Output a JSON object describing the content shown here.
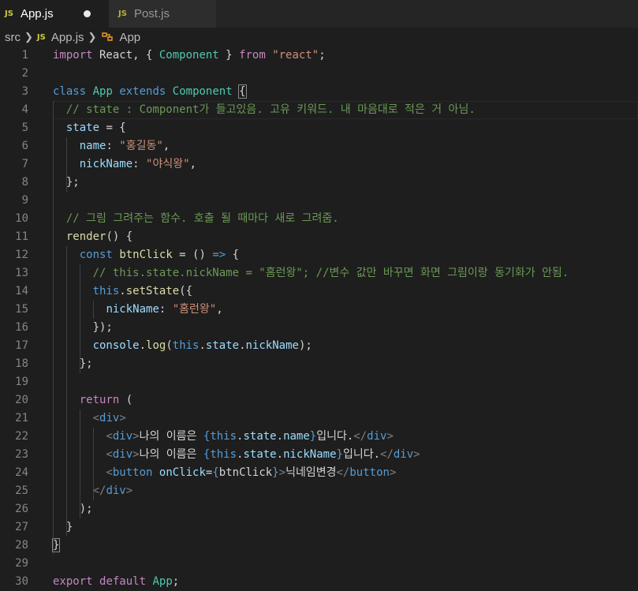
{
  "tabs": [
    {
      "label": "App.js",
      "badge": "JS",
      "active": true,
      "unsaved": true
    },
    {
      "label": "Post.js",
      "badge": "JS",
      "active": false
    }
  ],
  "breadcrumb": {
    "folder": "src",
    "file": "App.js",
    "file_badge": "JS",
    "symbol": "App"
  },
  "editor": {
    "line_numbers": [
      "1",
      "2",
      "3",
      "4",
      "5",
      "6",
      "7",
      "8",
      "9",
      "10",
      "11",
      "12",
      "13",
      "14",
      "15",
      "16",
      "17",
      "18",
      "19",
      "20",
      "21",
      "22",
      "23",
      "24",
      "25",
      "26",
      "27",
      "28",
      "29",
      "30"
    ],
    "lines": [
      [
        {
          "t": "import",
          "c": "ctl"
        },
        {
          "t": " React, { ",
          "c": "txt"
        },
        {
          "t": "Component",
          "c": "cls"
        },
        {
          "t": " } ",
          "c": "txt"
        },
        {
          "t": "from",
          "c": "ctl"
        },
        {
          "t": " ",
          "c": "txt"
        },
        {
          "t": "\"react\"",
          "c": "str"
        },
        {
          "t": ";",
          "c": "txt"
        }
      ],
      [],
      [
        {
          "t": "class",
          "c": "kw"
        },
        {
          "t": " ",
          "c": "txt"
        },
        {
          "t": "App",
          "c": "cls"
        },
        {
          "t": " ",
          "c": "txt"
        },
        {
          "t": "extends",
          "c": "kw"
        },
        {
          "t": " ",
          "c": "txt"
        },
        {
          "t": "Component",
          "c": "cls"
        },
        {
          "t": " ",
          "c": "txt"
        },
        {
          "t": "{",
          "c": "brm"
        }
      ],
      [
        {
          "t": "  ",
          "c": "txt"
        },
        {
          "t": "// state : Component가 들고있음. 고유 키워드. 내 마음대로 적은 거 아님.",
          "c": "cm"
        }
      ],
      [
        {
          "t": "  ",
          "c": "txt"
        },
        {
          "t": "state",
          "c": "prop"
        },
        {
          "t": " = {",
          "c": "txt"
        }
      ],
      [
        {
          "t": "    ",
          "c": "txt"
        },
        {
          "t": "name",
          "c": "prop"
        },
        {
          "t": ": ",
          "c": "txt"
        },
        {
          "t": "\"홍길동\"",
          "c": "str"
        },
        {
          "t": ",",
          "c": "txt"
        }
      ],
      [
        {
          "t": "    ",
          "c": "txt"
        },
        {
          "t": "nickName",
          "c": "prop"
        },
        {
          "t": ": ",
          "c": "txt"
        },
        {
          "t": "\"야식왕\"",
          "c": "str"
        },
        {
          "t": ",",
          "c": "txt"
        }
      ],
      [
        {
          "t": "  };",
          "c": "txt"
        }
      ],
      [],
      [
        {
          "t": "  ",
          "c": "txt"
        },
        {
          "t": "// 그림 그려주는 함수. 호출 될 때마다 새로 그려줌.",
          "c": "cm"
        }
      ],
      [
        {
          "t": "  ",
          "c": "txt"
        },
        {
          "t": "render",
          "c": "fn"
        },
        {
          "t": "() {",
          "c": "txt"
        }
      ],
      [
        {
          "t": "    ",
          "c": "txt"
        },
        {
          "t": "const",
          "c": "kw"
        },
        {
          "t": " ",
          "c": "txt"
        },
        {
          "t": "btnClick",
          "c": "fn"
        },
        {
          "t": " = () ",
          "c": "txt"
        },
        {
          "t": "=>",
          "c": "kw"
        },
        {
          "t": " {",
          "c": "txt"
        }
      ],
      [
        {
          "t": "      ",
          "c": "txt"
        },
        {
          "t": "// this.state.nickName = \"홈런왕\"; //변수 값만 바꾸면 화면 그림이랑 동기화가 안됨.",
          "c": "cm"
        }
      ],
      [
        {
          "t": "      ",
          "c": "txt"
        },
        {
          "t": "this",
          "c": "kw"
        },
        {
          "t": ".",
          "c": "txt"
        },
        {
          "t": "setState",
          "c": "fn"
        },
        {
          "t": "({",
          "c": "txt"
        }
      ],
      [
        {
          "t": "        ",
          "c": "txt"
        },
        {
          "t": "nickName",
          "c": "prop"
        },
        {
          "t": ": ",
          "c": "txt"
        },
        {
          "t": "\"홈런왕\"",
          "c": "str"
        },
        {
          "t": ",",
          "c": "txt"
        }
      ],
      [
        {
          "t": "      });",
          "c": "txt"
        }
      ],
      [
        {
          "t": "      ",
          "c": "txt"
        },
        {
          "t": "console",
          "c": "prop"
        },
        {
          "t": ".",
          "c": "txt"
        },
        {
          "t": "log",
          "c": "fn"
        },
        {
          "t": "(",
          "c": "txt"
        },
        {
          "t": "this",
          "c": "kw"
        },
        {
          "t": ".",
          "c": "txt"
        },
        {
          "t": "state",
          "c": "prop"
        },
        {
          "t": ".",
          "c": "txt"
        },
        {
          "t": "nickName",
          "c": "prop"
        },
        {
          "t": ");",
          "c": "txt"
        }
      ],
      [
        {
          "t": "    };",
          "c": "txt"
        }
      ],
      [],
      [
        {
          "t": "    ",
          "c": "txt"
        },
        {
          "t": "return",
          "c": "ctl"
        },
        {
          "t": " (",
          "c": "txt"
        }
      ],
      [
        {
          "t": "      ",
          "c": "txt"
        },
        {
          "t": "<",
          "c": "tagb"
        },
        {
          "t": "div",
          "c": "tag"
        },
        {
          "t": ">",
          "c": "tagb"
        }
      ],
      [
        {
          "t": "        ",
          "c": "txt"
        },
        {
          "t": "<",
          "c": "tagb"
        },
        {
          "t": "div",
          "c": "tag"
        },
        {
          "t": ">",
          "c": "tagb"
        },
        {
          "t": "나의 이름은 ",
          "c": "txt"
        },
        {
          "t": "{",
          "c": "kw"
        },
        {
          "t": "this",
          "c": "kw"
        },
        {
          "t": ".",
          "c": "txt"
        },
        {
          "t": "state",
          "c": "prop"
        },
        {
          "t": ".",
          "c": "txt"
        },
        {
          "t": "name",
          "c": "prop"
        },
        {
          "t": "}",
          "c": "kw"
        },
        {
          "t": "입니다.",
          "c": "txt"
        },
        {
          "t": "</",
          "c": "tagb"
        },
        {
          "t": "div",
          "c": "tag"
        },
        {
          "t": ">",
          "c": "tagb"
        }
      ],
      [
        {
          "t": "        ",
          "c": "txt"
        },
        {
          "t": "<",
          "c": "tagb"
        },
        {
          "t": "div",
          "c": "tag"
        },
        {
          "t": ">",
          "c": "tagb"
        },
        {
          "t": "나의 이름은 ",
          "c": "txt"
        },
        {
          "t": "{",
          "c": "kw"
        },
        {
          "t": "this",
          "c": "kw"
        },
        {
          "t": ".",
          "c": "txt"
        },
        {
          "t": "state",
          "c": "prop"
        },
        {
          "t": ".",
          "c": "txt"
        },
        {
          "t": "nickName",
          "c": "prop"
        },
        {
          "t": "}",
          "c": "kw"
        },
        {
          "t": "입니다.",
          "c": "txt"
        },
        {
          "t": "</",
          "c": "tagb"
        },
        {
          "t": "div",
          "c": "tag"
        },
        {
          "t": ">",
          "c": "tagb"
        }
      ],
      [
        {
          "t": "        ",
          "c": "txt"
        },
        {
          "t": "<",
          "c": "tagb"
        },
        {
          "t": "button",
          "c": "tag"
        },
        {
          "t": " ",
          "c": "txt"
        },
        {
          "t": "onClick",
          "c": "attr"
        },
        {
          "t": "=",
          "c": "txt"
        },
        {
          "t": "{",
          "c": "kw"
        },
        {
          "t": "btnClick",
          "c": "txt"
        },
        {
          "t": "}",
          "c": "kw"
        },
        {
          "t": ">",
          "c": "tagb"
        },
        {
          "t": "닉네임변경",
          "c": "txt"
        },
        {
          "t": "</",
          "c": "tagb"
        },
        {
          "t": "button",
          "c": "tag"
        },
        {
          "t": ">",
          "c": "tagb"
        }
      ],
      [
        {
          "t": "      ",
          "c": "txt"
        },
        {
          "t": "</",
          "c": "tagb"
        },
        {
          "t": "div",
          "c": "tag"
        },
        {
          "t": ">",
          "c": "tagb"
        }
      ],
      [
        {
          "t": "    );",
          "c": "txt"
        }
      ],
      [
        {
          "t": "  }",
          "c": "txt"
        }
      ],
      [
        {
          "t": "}",
          "c": "brm"
        }
      ],
      [],
      [
        {
          "t": "export",
          "c": "ctl"
        },
        {
          "t": " ",
          "c": "txt"
        },
        {
          "t": "default",
          "c": "ctl"
        },
        {
          "t": " ",
          "c": "txt"
        },
        {
          "t": "App",
          "c": "cls"
        },
        {
          "t": ";",
          "c": "txt"
        }
      ]
    ]
  }
}
